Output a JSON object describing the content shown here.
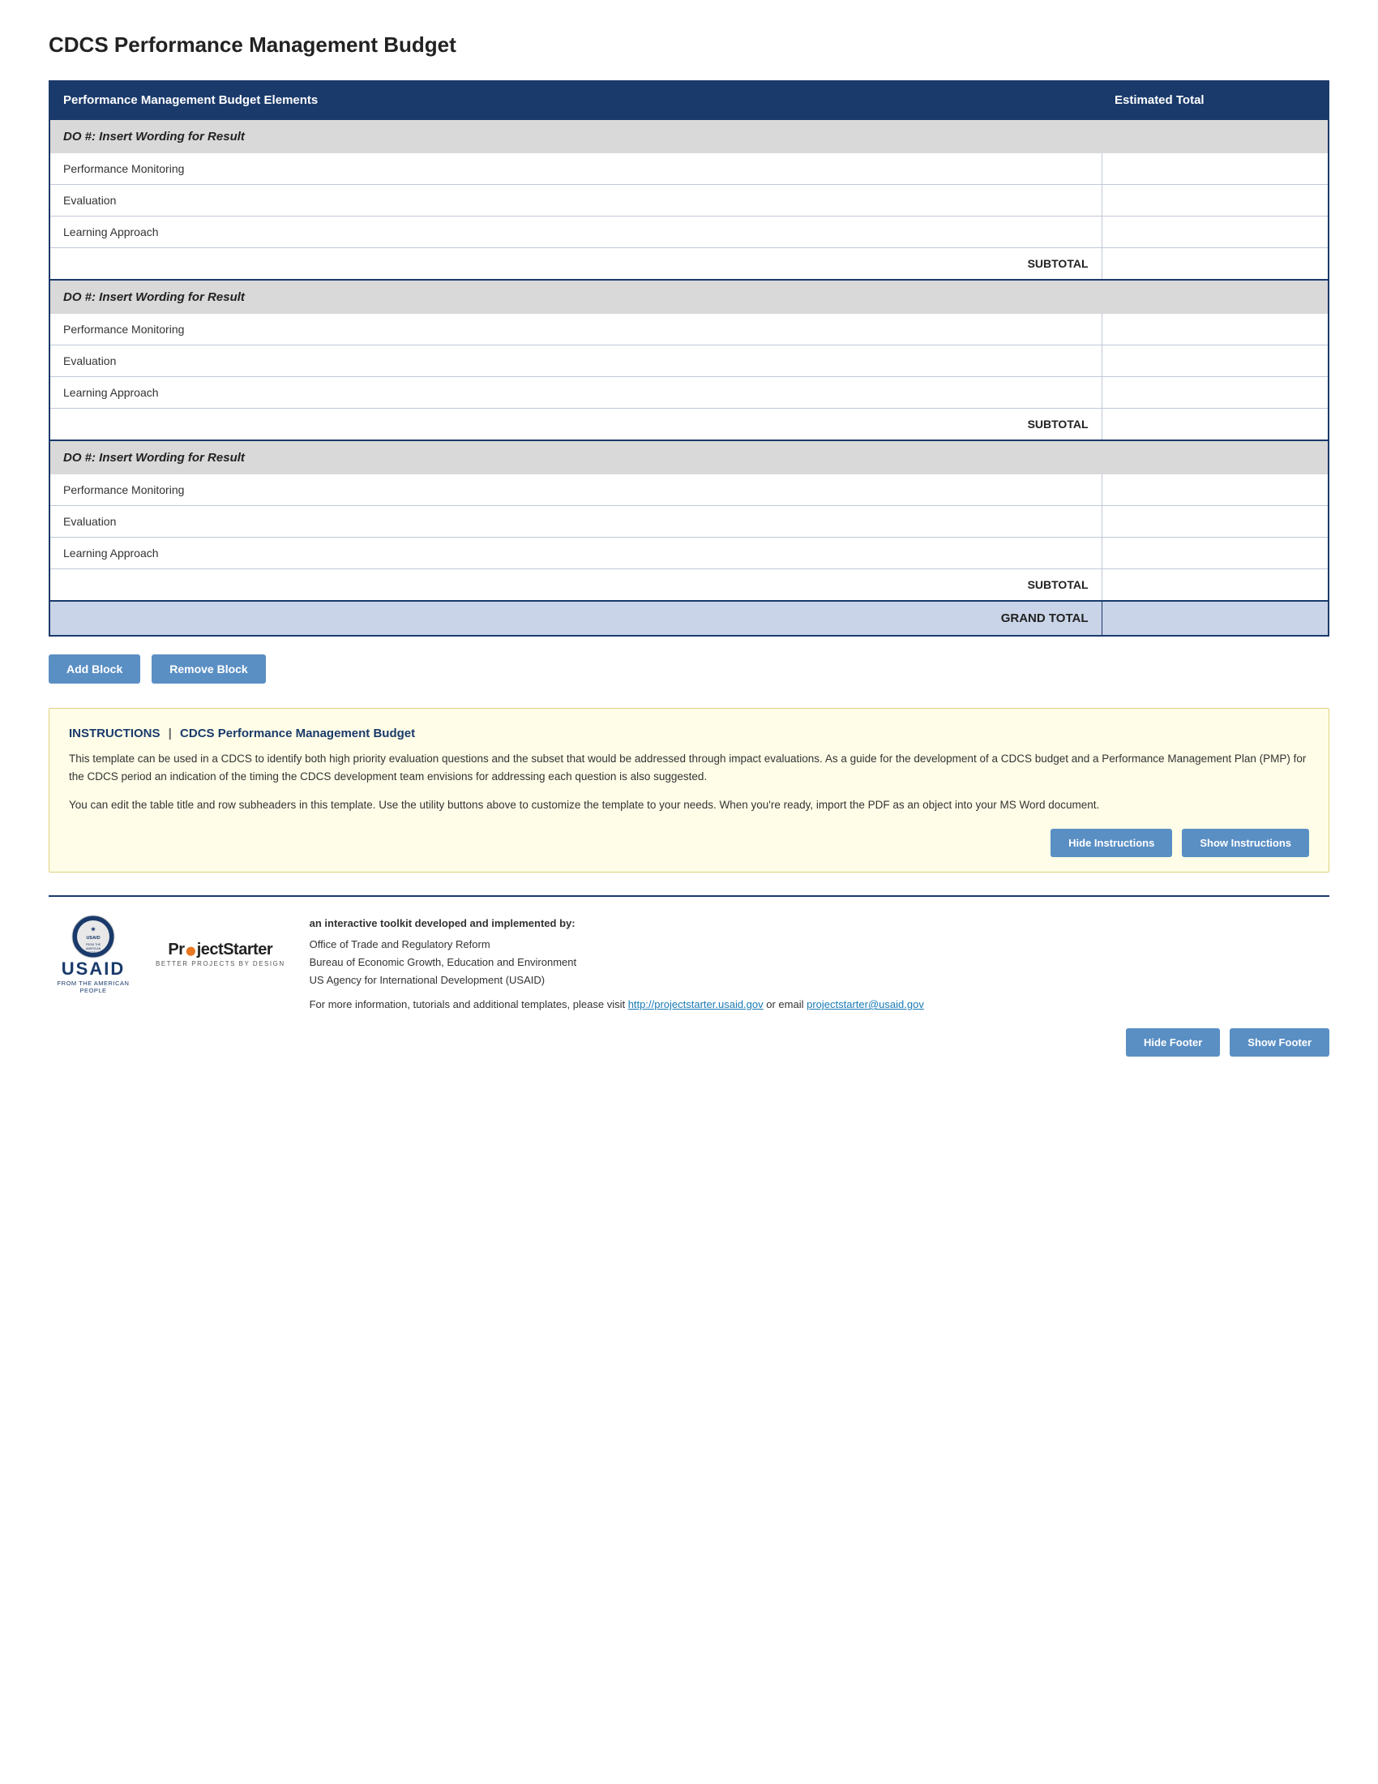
{
  "page": {
    "title": "CDCS Performance Management Budget"
  },
  "table": {
    "col_elements": "Performance Management Budget Elements",
    "col_total": "Estimated Total",
    "blocks": [
      {
        "id": 1,
        "section_label": "DO #: Insert Wording for Result",
        "rows": [
          {
            "label": "Performance Monitoring",
            "value": ""
          },
          {
            "label": "Evaluation",
            "value": ""
          },
          {
            "label": "Learning Approach",
            "value": ""
          }
        ],
        "subtotal_label": "SUBTOTAL",
        "subtotal_value": ""
      },
      {
        "id": 2,
        "section_label": "DO #: Insert Wording for Result",
        "rows": [
          {
            "label": "Performance Monitoring",
            "value": ""
          },
          {
            "label": "Evaluation",
            "value": ""
          },
          {
            "label": "Learning Approach",
            "value": ""
          }
        ],
        "subtotal_label": "SUBTOTAL",
        "subtotal_value": ""
      },
      {
        "id": 3,
        "section_label": "DO #: Insert Wording for Result",
        "rows": [
          {
            "label": "Performance Monitoring",
            "value": ""
          },
          {
            "label": "Evaluation",
            "value": ""
          },
          {
            "label": "Learning Approach",
            "value": ""
          }
        ],
        "subtotal_label": "SUBTOTAL",
        "subtotal_value": ""
      }
    ],
    "grand_total_label": "GRAND TOTAL",
    "grand_total_value": ""
  },
  "buttons": {
    "add_block": "Add Block",
    "remove_block": "Remove Block"
  },
  "instructions": {
    "label": "INSTRUCTIONS",
    "separator": "|",
    "title_name": "CDCS Performance Management Budget",
    "paragraph1": "This template can be used in a CDCS to identify both high priority evaluation questions and the subset that would be addressed through impact evaluations. As a guide for the development of a CDCS budget and a Performance Management Plan (PMP) for the CDCS period an indication of the timing the CDCS development team envisions for addressing each question is also suggested.",
    "paragraph2": "You can edit the table title and row subheaders in this template. Use the utility buttons above to customize the template to your needs. When you're ready, import the PDF as an object into your MS Word document.",
    "hide_btn": "Hide Instructions",
    "show_btn": "Show Instructions"
  },
  "footer": {
    "usaid_name": "USAID",
    "usaid_tagline": "FROM THE AMERICAN PEOPLE",
    "ps_name_pre": "Pr",
    "ps_name_post": "jectStarter",
    "ps_subtitle": "BETTER PROJECTS BY DESIGN",
    "developed_by": "an interactive toolkit developed and implemented by:",
    "org1": "Office of Trade and Regulatory Reform",
    "org2": "Bureau of Economic Growth, Education and Environment",
    "org3": "US Agency for International Development (USAID)",
    "more_info_pre": "For more information, tutorials and additional templates, please visit ",
    "link1_text": "http://projectstarter.usaid.gov",
    "link1_href": "http://projectstarter.usaid.gov",
    "more_info_mid": " or email ",
    "link2_text": "projectstarter@usaid.gov",
    "link2_href": "mailto:projectstarter@usaid.gov",
    "hide_footer_btn": "Hide Footer",
    "show_footer_btn": "Show Footer"
  }
}
